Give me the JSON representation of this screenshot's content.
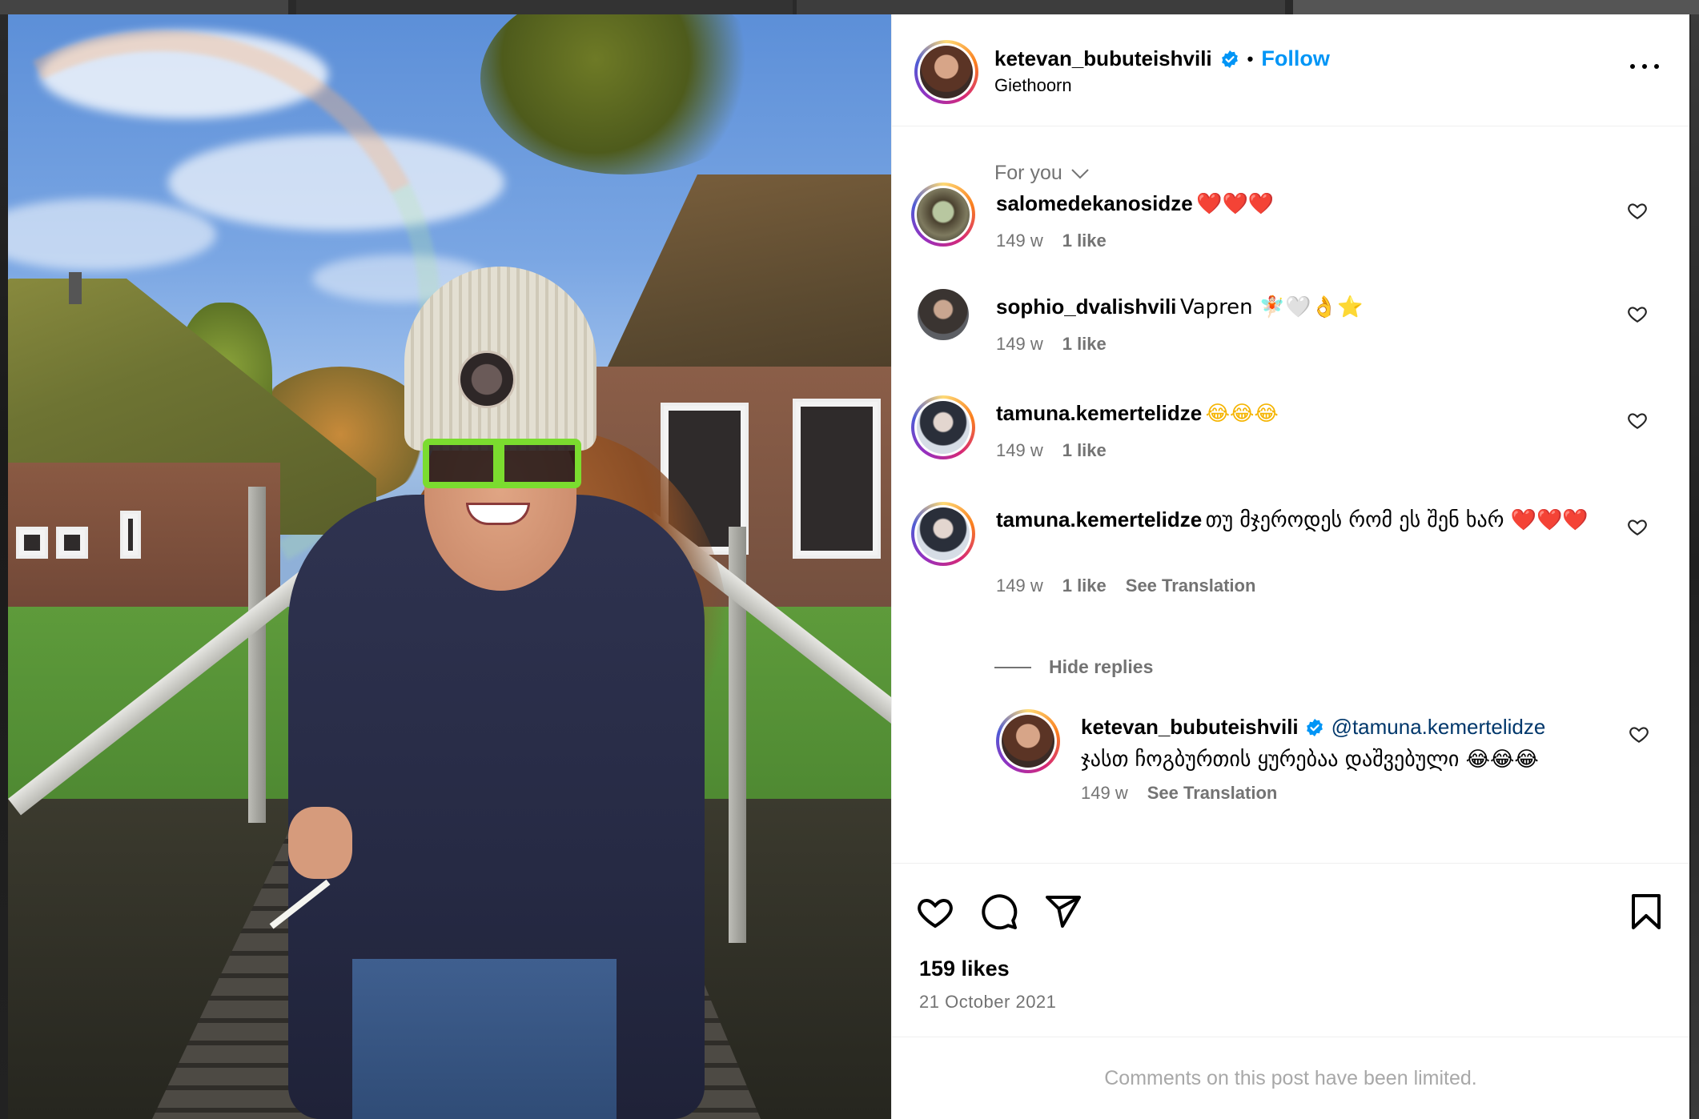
{
  "post": {
    "author": "ketevan_bubuteishvili",
    "follow_label": "Follow",
    "separator": "•",
    "location": "Giethoorn",
    "more_label": "More options"
  },
  "comments_section": {
    "filter_label": "For you",
    "comments": [
      {
        "user": "salomedekanosidze",
        "text": "❤️❤️❤️",
        "age": "149 w",
        "likes": "1 like"
      },
      {
        "user": "sophio_dvalishvili",
        "text": "Vapren 🧚🏻🤍👌⭐️",
        "age": "149 w",
        "likes": "1 like"
      },
      {
        "user": "tamuna.kemertelidze",
        "text": "😂😂😂",
        "age": "149 w",
        "likes": "1 like"
      },
      {
        "user": "tamuna.kemertelidze",
        "text": "თუ მჯეროდეს რომ ეს შენ ხარ ❤️❤️❤️",
        "age": "149 w",
        "likes": "1 like",
        "translate": "See Translation"
      }
    ],
    "hide_replies_label": "Hide replies",
    "reply": {
      "user": "ketevan_bubuteishvili",
      "mention": "@tamuna.kemertelidze",
      "text": "ჯასთ ჩოგბურთის ყურებაა დაშვებული 😂😂😂",
      "age": "149 w",
      "translate": "See Translation"
    }
  },
  "engagement": {
    "likes": "159 likes",
    "date": "21 October 2021",
    "limited_notice": "Comments on this post have been limited."
  },
  "colors": {
    "follow": "#0095f6",
    "secondary_text": "#737373",
    "mention": "#00376b",
    "verified": "#0095f6"
  },
  "icons": [
    "verified-badge-icon",
    "more-icon",
    "chevron-down-icon",
    "heart-icon",
    "comment-icon",
    "share-icon",
    "bookmark-icon"
  ]
}
